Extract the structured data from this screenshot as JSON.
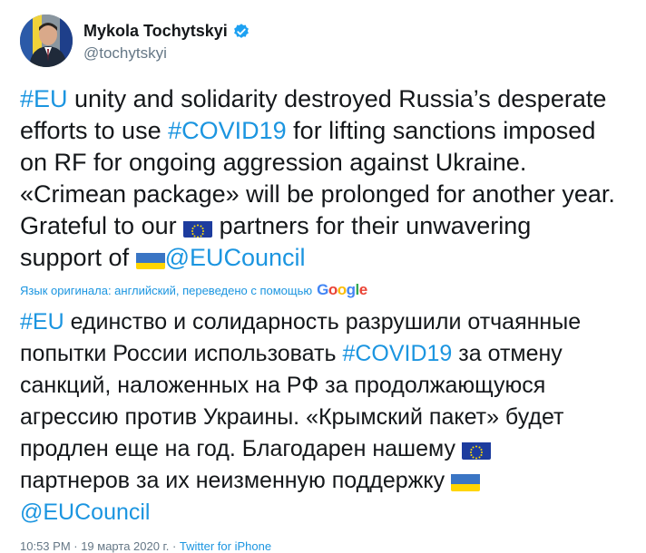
{
  "author": {
    "display_name": "Mykola Tochytskyi",
    "handle": "@tochytskyi",
    "verified_icon": "verified-badge-icon"
  },
  "tweet": {
    "line1": {
      "tag": "#EU",
      "text": " unity and solidarity destroyed Russia’s desperate"
    },
    "line2": {
      "text": "efforts to use ",
      "tag": "#COVID19",
      "text2": " for lifting sanctions imposed"
    },
    "line3": {
      "text": "on RF for ongoing aggression against Ukraine."
    },
    "line4": {
      "text": "«Crimean package» will be prolonged for another year."
    },
    "line5": {
      "text": "Grateful to our ",
      "text2": " partners for their unwavering"
    },
    "line6": {
      "text": "support of ",
      "mention": "@EUCouncil"
    }
  },
  "translation_note": {
    "label": "Язык оригинала: английский, переведено с помощью",
    "provider": "Google"
  },
  "translated": {
    "line1": {
      "tag": "#EU",
      "text": " единство и солидарность разрушили отчаянные"
    },
    "line2": {
      "text": "попытки России использовать ",
      "tag": "#COVID19",
      "text2": " за отмену"
    },
    "line3": {
      "text": "санкций, наложенных на РФ за продолжающуюся"
    },
    "line4": {
      "text": "агрессию против Украины. «Крымский пакет» будет"
    },
    "line5": {
      "text": "продлен еще на год. Благодарен нашему "
    },
    "line6": {
      "text": "партнеров за их неизменную поддержку "
    },
    "line7": {
      "mention": "@EUCouncil"
    }
  },
  "footer": {
    "time_text": "10:53 PM · 19 марта 2020 г. · ",
    "source": "Twitter for iPhone"
  },
  "icons": {
    "eu_flag": "eu-flag-emoji-icon",
    "ukraine_flag": "ukraine-flag-emoji-icon"
  },
  "colors": {
    "link": "#1b95e0",
    "text": "#14171a",
    "muted": "#657786",
    "eu_blue": "#1d3c9e",
    "eu_star": "#ffdd00",
    "ua_blue": "#3a75c4",
    "ua_yellow": "#ffd500"
  }
}
